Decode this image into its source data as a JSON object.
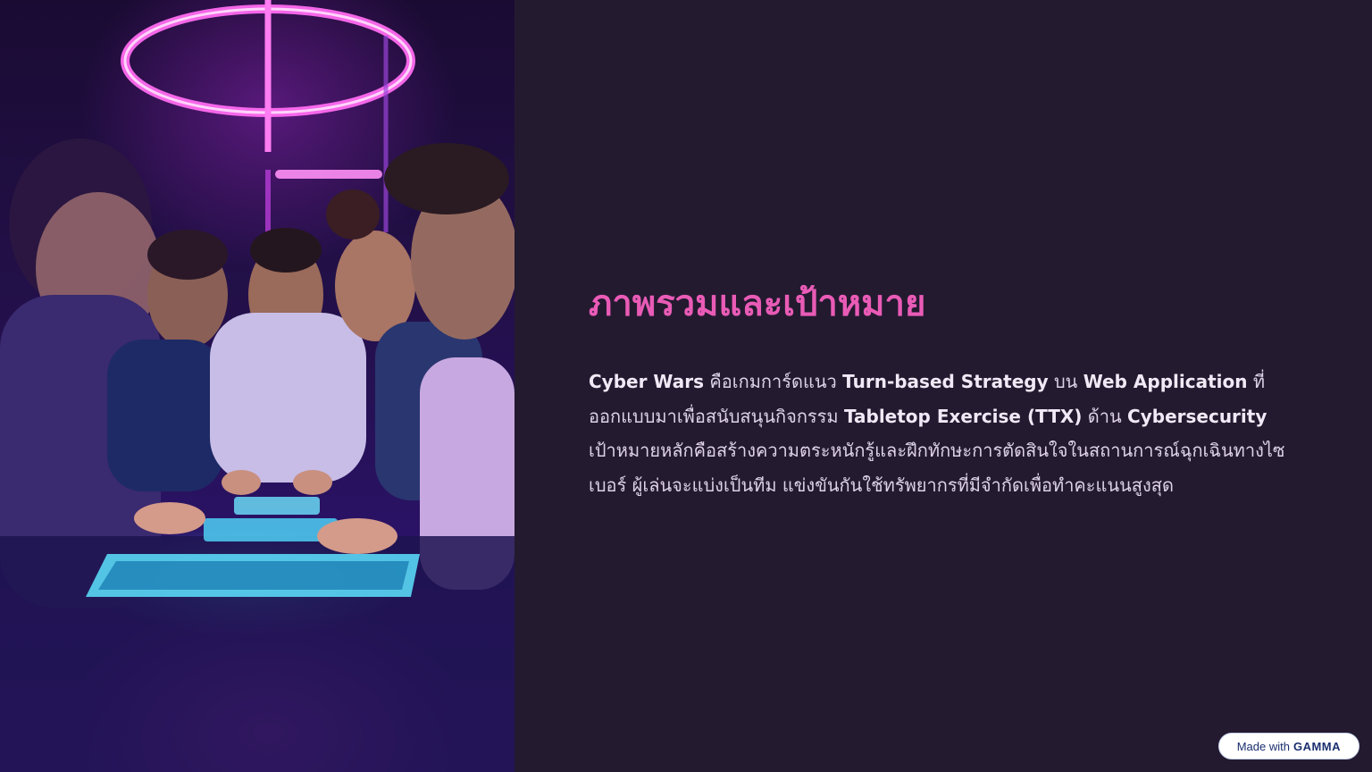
{
  "slide": {
    "title": "ภาพรวมและเป้าหมาย",
    "paragraph": {
      "line1": [
        {
          "bold": true,
          "text": "Cyber Wars"
        },
        {
          "bold": false,
          "text": " คือเกมการ์ดแนว "
        },
        {
          "bold": true,
          "text": "Turn-based Strategy"
        },
        {
          "bold": false,
          "text": " บน "
        },
        {
          "bold": true,
          "text": "Web Application"
        },
        {
          "bold": false,
          "text": " ที่"
        }
      ],
      "line2": [
        {
          "bold": false,
          "text": "ออกแบบมาเพื่อสนับสนุนกิจกรรม "
        },
        {
          "bold": true,
          "text": "Tabletop Exercise (TTX)"
        },
        {
          "bold": false,
          "text": " ด้าน "
        },
        {
          "bold": true,
          "text": "Cybersecurity"
        }
      ],
      "line3": "เป้าหมายหลักคือสร้างความตระหนักรู้และฝึกทักษะการตัดสินใจในสถานการณ์ฉุกเฉินทางไซ",
      "line4": "เบอร์ ผู้เล่นจะแบ่งเป็นทีม แข่งขันกันใช้ทรัพยากรที่มีจำกัดเพื่อทำคะแนนสูงสุด"
    }
  },
  "badge": {
    "prefix": "Made with",
    "brand": "GAMMA"
  },
  "colors": {
    "background": "#241a30",
    "title": "#e95bb6",
    "body_text": "#ddd2e6"
  }
}
